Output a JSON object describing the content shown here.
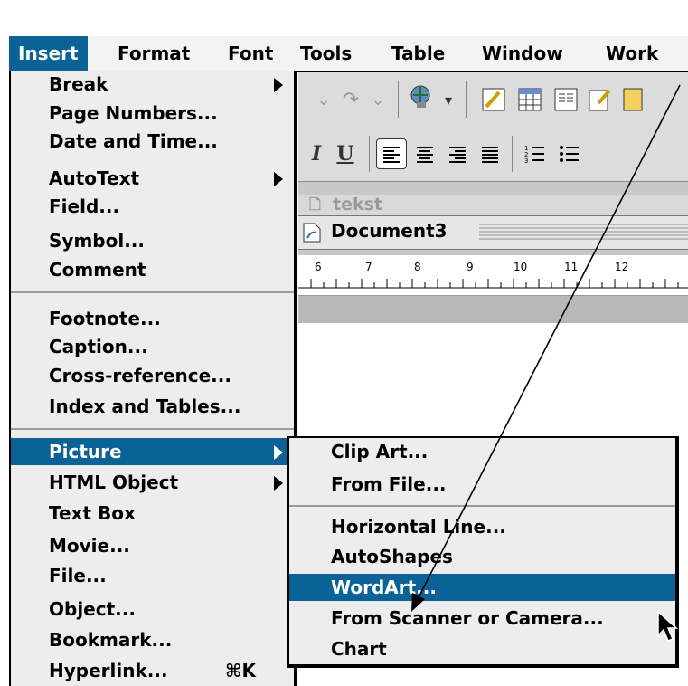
{
  "menubar": {
    "items": [
      "Insert",
      "Format",
      "Font",
      "Tools",
      "Table",
      "Window",
      "Work"
    ]
  },
  "insert_menu": {
    "items": [
      {
        "label": "Break",
        "submenu": true
      },
      {
        "label": "Page Numbers..."
      },
      {
        "label": "Date and Time..."
      },
      {
        "label": "AutoText",
        "submenu": true
      },
      {
        "label": "Field..."
      },
      {
        "label": "Symbol..."
      },
      {
        "label": "Comment"
      },
      {
        "label": "Footnote..."
      },
      {
        "label": "Caption..."
      },
      {
        "label": "Cross-reference..."
      },
      {
        "label": "Index and Tables..."
      },
      {
        "label": "Picture",
        "submenu": true,
        "active": true
      },
      {
        "label": "HTML Object",
        "submenu": true
      },
      {
        "label": "Text Box"
      },
      {
        "label": "Movie..."
      },
      {
        "label": "File..."
      },
      {
        "label": "Object..."
      },
      {
        "label": "Bookmark..."
      },
      {
        "label": "Hyperlink...",
        "shortcut": "⌘K"
      }
    ]
  },
  "picture_submenu": {
    "items": [
      {
        "label": "Clip Art..."
      },
      {
        "label": "From File..."
      },
      {
        "label": "Horizontal Line..."
      },
      {
        "label": "AutoShapes"
      },
      {
        "label": "WordArt...",
        "active": true
      },
      {
        "label": "From Scanner or Camera..."
      },
      {
        "label": "Chart"
      }
    ]
  },
  "document": {
    "back_window_title": "tekst",
    "window_title": "Document3"
  },
  "ruler": {
    "numbers": [
      "6",
      "7",
      "8",
      "9",
      "10",
      "11",
      "12"
    ]
  },
  "toolbar": {
    "italic": "I",
    "underline": "U"
  },
  "colors": {
    "highlight": "#0a6296",
    "menu_bg": "#ededed"
  }
}
